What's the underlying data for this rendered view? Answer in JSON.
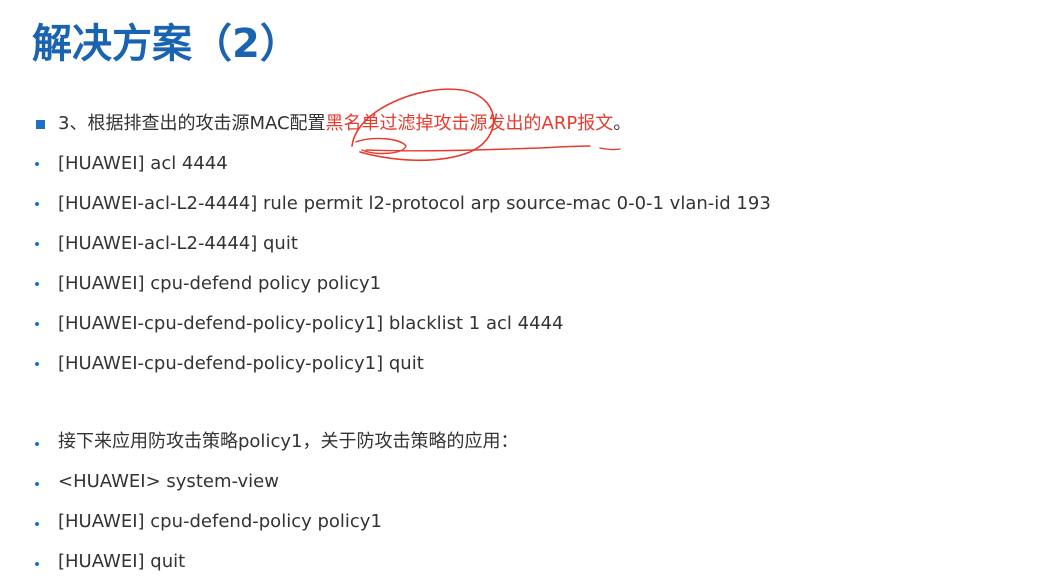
{
  "title": "解决方案（2）",
  "step": {
    "prefix": "3、根据排查出的攻击源MAC配置",
    "highlight": "黑名单过滤掉攻击源发出的ARP报文",
    "suffix": "。"
  },
  "commands1": [
    "[HUAWEI] acl 4444",
    "[HUAWEI-acl-L2-4444] rule permit l2-protocol arp source-mac 0-0-1 vlan-id 193",
    "[HUAWEI-acl-L2-4444] quit",
    "[HUAWEI] cpu-defend policy policy1",
    "[HUAWEI-cpu-defend-policy-policy1] blacklist 1 acl 4444",
    "[HUAWEI-cpu-defend-policy-policy1] quit"
  ],
  "apply_heading": "接下来应用防攻击策略policy1，关于防攻击策略的应用：",
  "commands2": [
    "<HUAWEI> system-view",
    "[HUAWEI] cpu-defend-policy policy1",
    "[HUAWEI] quit"
  ],
  "colors": {
    "title": "#1a63b0",
    "bullet": "#1f6fc5",
    "highlight": "#e63b2e",
    "annotation": "#e63b2e"
  }
}
